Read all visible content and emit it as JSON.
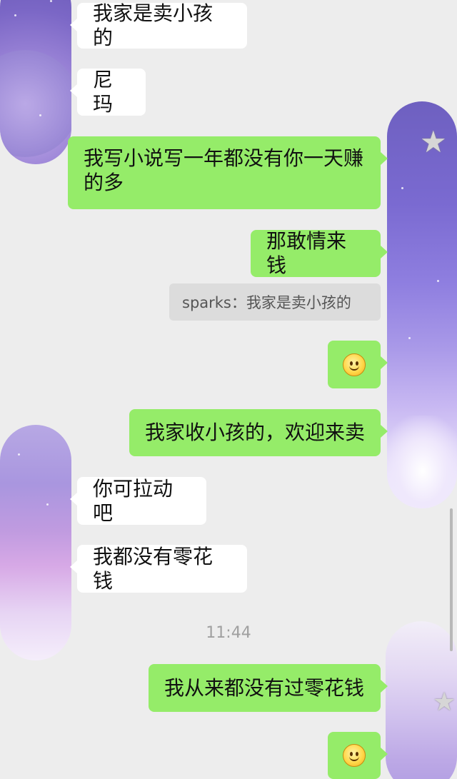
{
  "messages": [
    {
      "text": "我家是卖小孩的"
    },
    {
      "text": "尼玛"
    },
    {
      "line1": "我写小说写一年都没有你一天赚",
      "line2": "的多"
    },
    {
      "text": "那敢情来钱"
    },
    {
      "quote": "sparks：我家是卖小孩的"
    },
    {
      "emoji": "smile-emoji"
    },
    {
      "text": "我家收小孩的，欢迎来卖"
    },
    {
      "text": "你可拉动吧"
    },
    {
      "text": "我都没有零花钱"
    },
    {
      "text": "我从来都没有过零花钱"
    },
    {
      "emoji": "smile-emoji"
    }
  ],
  "timestamp": "11:44",
  "colors": {
    "background": "#ededed",
    "incoming_bubble": "#ffffff",
    "outgoing_bubble": "#95ec69",
    "quote_bg": "#dcdcdc"
  }
}
